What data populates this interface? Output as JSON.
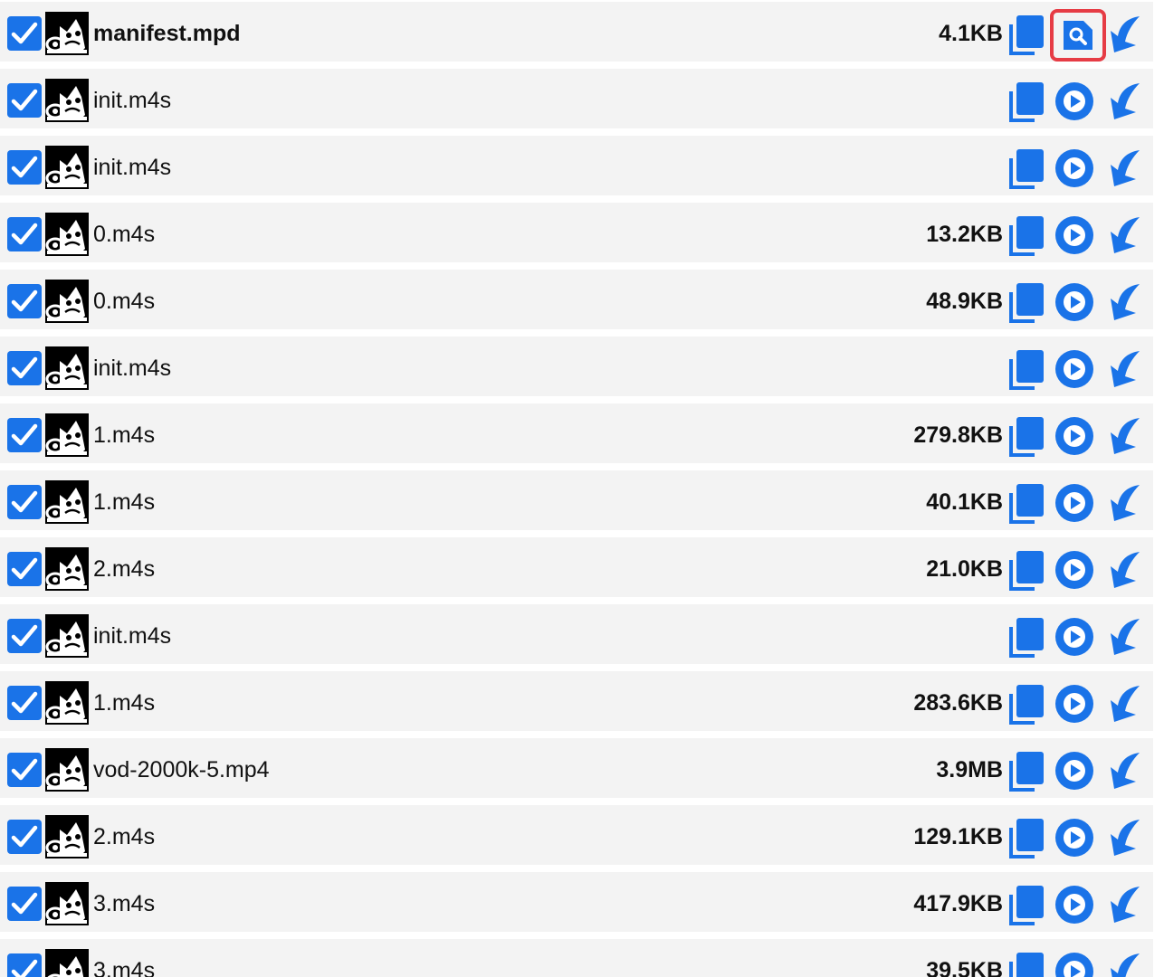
{
  "accent_color": "#1a73e8",
  "highlight_color": "#e63c45",
  "rows": [
    {
      "name": "manifest.mpd",
      "size": "4.1KB",
      "checked": true,
      "bold": true,
      "action": "view"
    },
    {
      "name": "init.m4s",
      "size": "",
      "checked": true,
      "bold": false,
      "action": "play"
    },
    {
      "name": "init.m4s",
      "size": "",
      "checked": true,
      "bold": false,
      "action": "play"
    },
    {
      "name": "0.m4s",
      "size": "13.2KB",
      "checked": true,
      "bold": false,
      "action": "play"
    },
    {
      "name": "0.m4s",
      "size": "48.9KB",
      "checked": true,
      "bold": false,
      "action": "play"
    },
    {
      "name": "init.m4s",
      "size": "",
      "checked": true,
      "bold": false,
      "action": "play"
    },
    {
      "name": "1.m4s",
      "size": "279.8KB",
      "checked": true,
      "bold": false,
      "action": "play"
    },
    {
      "name": "1.m4s",
      "size": "40.1KB",
      "checked": true,
      "bold": false,
      "action": "play"
    },
    {
      "name": "2.m4s",
      "size": "21.0KB",
      "checked": true,
      "bold": false,
      "action": "play"
    },
    {
      "name": "init.m4s",
      "size": "",
      "checked": true,
      "bold": false,
      "action": "play"
    },
    {
      "name": "1.m4s",
      "size": "283.6KB",
      "checked": true,
      "bold": false,
      "action": "play"
    },
    {
      "name": "vod-2000k-5.mp4",
      "size": "3.9MB",
      "checked": true,
      "bold": false,
      "action": "play"
    },
    {
      "name": "2.m4s",
      "size": "129.1KB",
      "checked": true,
      "bold": false,
      "action": "play"
    },
    {
      "name": "3.m4s",
      "size": "417.9KB",
      "checked": true,
      "bold": false,
      "action": "play"
    },
    {
      "name": "3.m4s",
      "size": "39.5KB",
      "checked": true,
      "bold": false,
      "action": "play"
    }
  ]
}
